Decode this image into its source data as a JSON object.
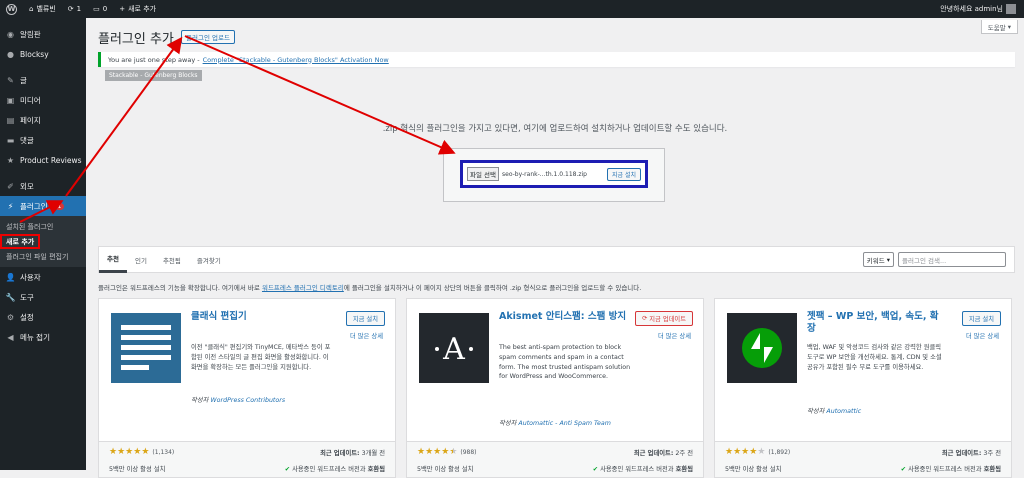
{
  "adminbar": {
    "site_name": "벨류빈",
    "updates_count": "1",
    "comments_count": "0",
    "new_label": "새로 추가",
    "greeting": "안녕하세요 admin님"
  },
  "sidebar": {
    "items": [
      {
        "label": "알림판",
        "icon": "dashboard-icon"
      },
      {
        "label": "Blocksy",
        "icon": "blocksy-icon"
      },
      {
        "label": "글",
        "icon": "pin-icon"
      },
      {
        "label": "미디어",
        "icon": "media-icon"
      },
      {
        "label": "페이지",
        "icon": "page-icon"
      },
      {
        "label": "댓글",
        "icon": "comment-icon"
      },
      {
        "label": "Product Reviews",
        "icon": "star-icon"
      },
      {
        "label": "외모",
        "icon": "brush-icon"
      },
      {
        "label": "플러그인",
        "icon": "plugin-icon",
        "badge": "1"
      },
      {
        "label": "사용자",
        "icon": "user-icon"
      },
      {
        "label": "도구",
        "icon": "wrench-icon"
      },
      {
        "label": "설정",
        "icon": "settings-icon"
      },
      {
        "label": "메뉴 접기",
        "icon": "collapse-icon"
      }
    ],
    "plugin_submenu": [
      "설치된 플러그인",
      "새로 추가",
      "플러그인 파일 편집기"
    ]
  },
  "header": {
    "title": "플러그인 추가",
    "upload_button": "플러그인 업로드",
    "help_button": "도움말"
  },
  "notice": {
    "text": "You are just one step away -",
    "link": "Complete \"Stackable - Gutenberg Blocks\" Activation Now"
  },
  "tag_label": "Stackable - Gutenberg Blocks",
  "upload": {
    "description": ".zip 형식의 플러그인을 가지고 있다면, 여기에 업로드하여 설치하거나 업데이트할 수도 있습니다.",
    "file_button": "파일 선택",
    "file_name": "seo-by-rank-...th.1.0.118.zip",
    "install_button": "지금 설치"
  },
  "filter": {
    "tabs": [
      "추천",
      "인기",
      "추천됨",
      "즐겨찾기"
    ],
    "search_type": "키워드",
    "search_placeholder": "플러그인 검색...",
    "description_before": "플러그인은 워드프레스의 기능을 확장합니다. 여기에서 바로 ",
    "description_link": "워드프레스 플러그인 디렉토리",
    "description_after": "에 플러그인을 설치하거나 이 페이지 상단의 버튼을 클릭하여 .zip 형식으로 플러그인을 업로드할 수 있습니다."
  },
  "cards": [
    {
      "name": "클래식 편집기",
      "description": "이전 \"클래식\" 편집기와 TinyMCE, 메타박스 등이 포함된 이전 스타일의 글 편집 화면을 활성화합니다. 이 화면을 확장하는 모든 플러그인을 지원합니다.",
      "author_prefix": "작성자",
      "author": "WordPress Contributors",
      "action": "지금 설치",
      "more": "더 많은 상세",
      "rating": 5,
      "rating_count": "(1,134)",
      "installs": "5백만 이상 활성 설치",
      "updated_label": "최근 업데이트:",
      "updated": "3개월 전",
      "compat_prefix": "사용중인 워드프레스 버전과",
      "compat": "호환됨",
      "icon": "classic-editor-icon"
    },
    {
      "name": "Akismet 안티스팸: 스팸 방지",
      "description": "The best anti-spam protection to block spam comments and spam in a contact form. The most trusted antispam solution for WordPress and WooCommerce.",
      "author_prefix": "작성자",
      "author": "Automattic - Anti Spam Team",
      "action": "지금 업데이트",
      "more": "더 많은 상세",
      "rating": 4.5,
      "rating_count": "(988)",
      "installs": "5백만 이상 활성 설치",
      "updated_label": "최근 업데이트:",
      "updated": "2주 전",
      "compat_prefix": "사용중인 워드프레스 버전과",
      "compat": "호환됨",
      "icon": "akismet-icon"
    },
    {
      "name": "젯팩 – WP 보안, 백업, 속도, 확장",
      "description": "백업, WAF 및 악성코드 검사와 같은 강력한 원클릭 도구로 WP 보안을 개선하세요. 통계, CDN 및 소셜 공유가 포함된 필수 무료 도구를 이용하세요.",
      "author_prefix": "작성자",
      "author": "Automattic",
      "action": "지금 설치",
      "more": "더 많은 상세",
      "rating": 4,
      "rating_count": "(1,892)",
      "installs": "5백만 이상 활성 설치",
      "updated_label": "최근 업데이트:",
      "updated": "3주 전",
      "compat_prefix": "사용중인 워드프레스 버전과",
      "compat": "호환됨",
      "icon": "jetpack-icon"
    }
  ],
  "colors": {
    "admin_dark": "#1d2327",
    "accent": "#2271b1",
    "annotation_red": "#e00000",
    "annotation_blue": "#1d1db3"
  }
}
